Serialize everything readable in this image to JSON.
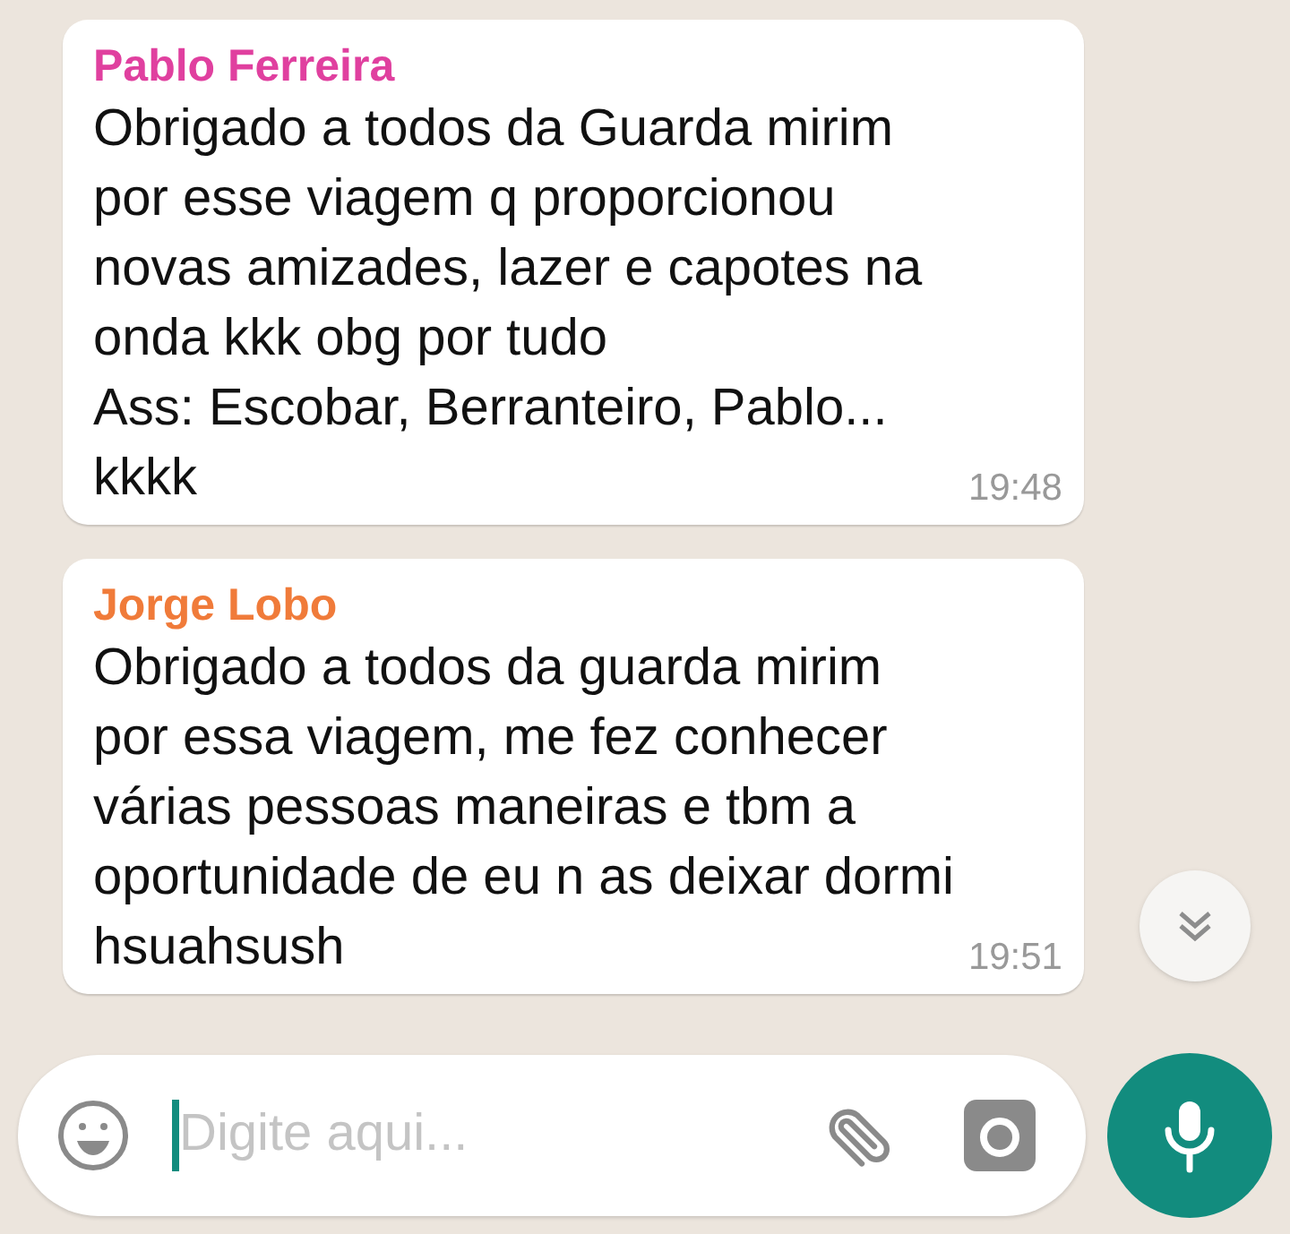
{
  "messages": [
    {
      "sender": "Pablo Ferreira",
      "color": "#e0409f",
      "text": "Obrigado a todos da Guarda mirim\npor esse viagem q proporcionou\nnovas amizades, lazer e capotes na\nonda kkk obg por tudo\nAss: Escobar, Berranteiro, Pablo...\nkkkk",
      "time": "19:48"
    },
    {
      "sender": "Jorge Lobo",
      "color": "#f07b3a",
      "text": "Obrigado a todos da guarda mirim\npor essa viagem, me fez conhecer\nvárias pessoas maneiras e tbm a\noportunidade de eu n as deixar dormi\nhsuahsush",
      "time": "19:51"
    }
  ],
  "composer": {
    "placeholder": "Digite aqui..."
  }
}
